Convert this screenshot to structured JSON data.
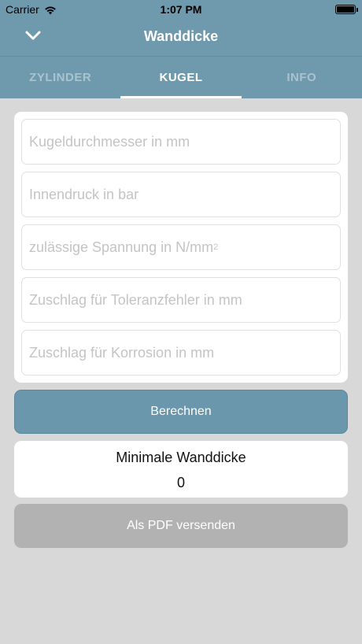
{
  "status_bar": {
    "carrier": "Carrier",
    "time": "1:07 PM",
    "icons": [
      "wifi-icon",
      "battery-icon"
    ]
  },
  "nav": {
    "title": "Wanddicke",
    "back_icon": "chevron-down-icon"
  },
  "tabs": [
    {
      "label": "ZYLINDER",
      "active": false
    },
    {
      "label": "KUGEL",
      "active": true
    },
    {
      "label": "INFO",
      "active": false
    }
  ],
  "form": {
    "fields": [
      {
        "placeholder": "Kugeldurchmesser in mm",
        "value": ""
      },
      {
        "placeholder": "Innendruck in bar",
        "value": ""
      },
      {
        "placeholder": "zulässige Spannung in N/mm",
        "placeholder_sup": "2",
        "value": ""
      },
      {
        "placeholder": "Zuschlag für Toleranzfehler in mm",
        "value": ""
      },
      {
        "placeholder": "Zuschlag für Korrosion in mm",
        "value": ""
      }
    ]
  },
  "actions": {
    "calculate_label": "Berechnen",
    "pdf_label": "Als PDF versenden"
  },
  "result": {
    "label": "Minimale Wanddicke",
    "value": "0"
  },
  "colors": {
    "header": "#6f99ad",
    "primary_button": "#6a97ab",
    "disabled_button": "#b2b2b2",
    "background": "#d8d8d8"
  }
}
